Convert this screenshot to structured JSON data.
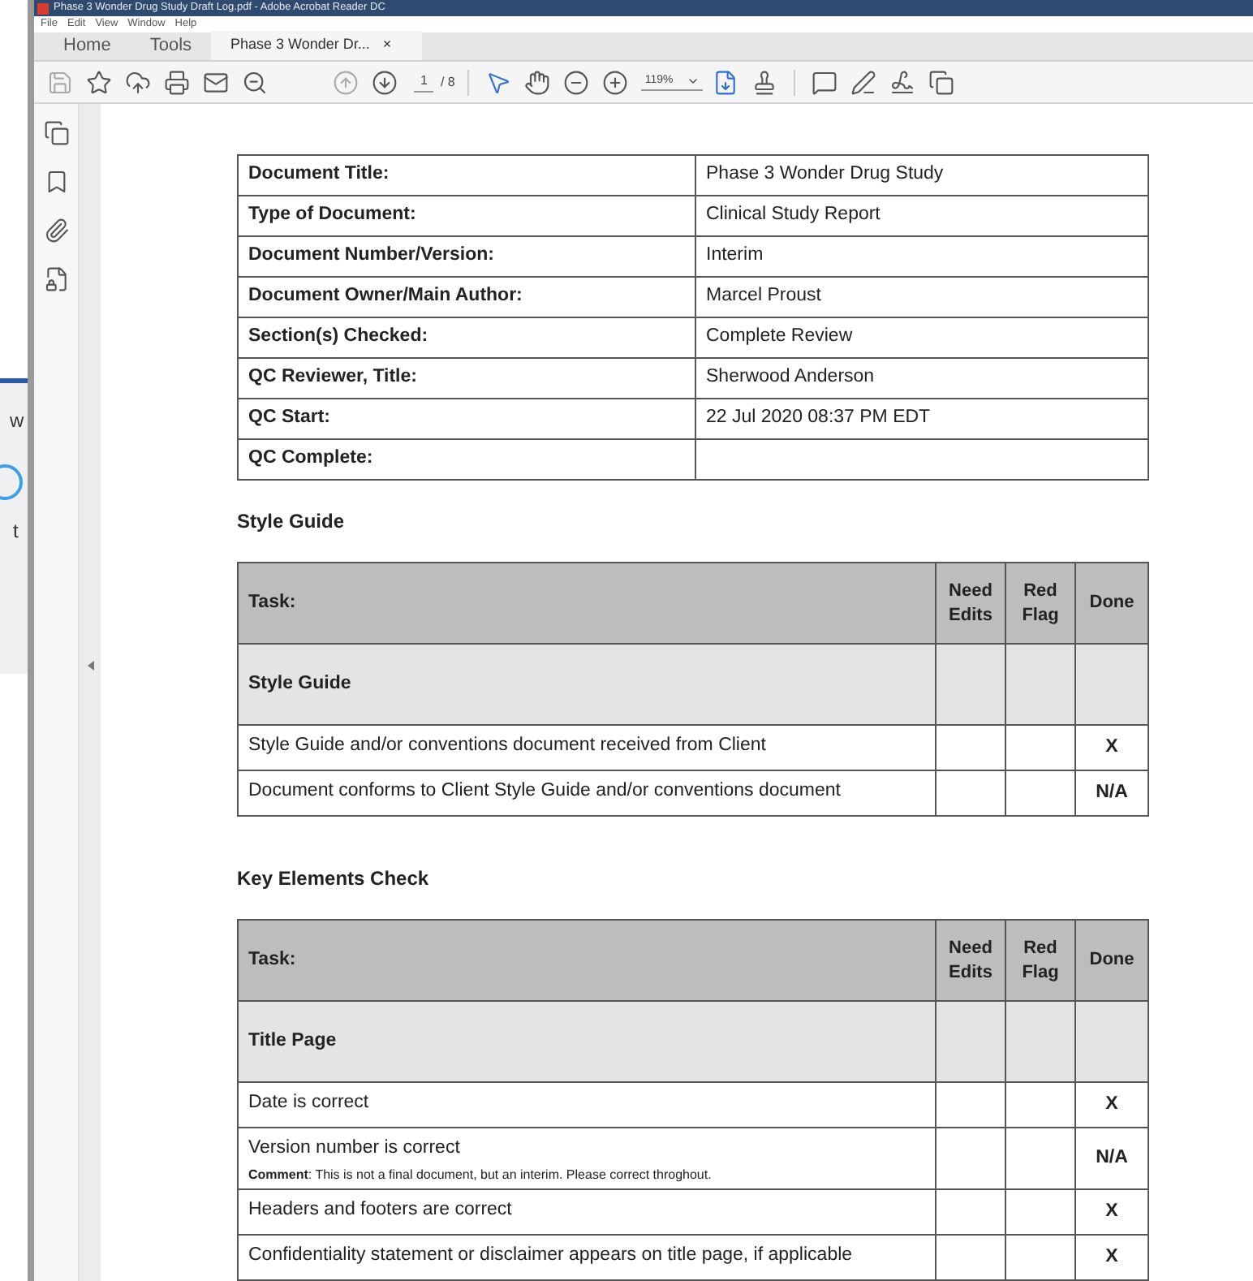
{
  "window": {
    "title": "Phase 3 Wonder Drug Study  Draft Log.pdf - Adobe Acrobat Reader DC"
  },
  "menu": [
    "File",
    "Edit",
    "View",
    "Window",
    "Help"
  ],
  "tabs": [
    {
      "label": "Home",
      "selected": false
    },
    {
      "label": "Tools",
      "selected": false
    },
    {
      "label": "Phase 3 Wonder Dr...",
      "selected": true,
      "close": "×"
    }
  ],
  "toolbar": {
    "page_number": "1",
    "page_total": "/ 8",
    "zoom": "119%"
  },
  "background_window": {
    "texts": [
      "w",
      "t"
    ]
  },
  "document": {
    "info_table": [
      {
        "label": "Document Title:",
        "value": "Phase 3 Wonder Drug Study"
      },
      {
        "label": "Type of Document:",
        "value": "Clinical Study Report"
      },
      {
        "label": "Document Number/Version:",
        "value": "Interim"
      },
      {
        "label": "Document Owner/Main Author:",
        "value": "Marcel Proust"
      },
      {
        "label": "Section(s) Checked:",
        "value": "Complete Review"
      },
      {
        "label": "QC Reviewer, Title:",
        "value": "Sherwood Anderson"
      },
      {
        "label": "QC Start:",
        "value": "22 Jul 2020 08:37 PM EDT"
      },
      {
        "label": "QC Complete:"
      }
    ],
    "sections": [
      {
        "heading": "Style Guide",
        "columns": [
          "Task:",
          "Need Edits",
          "Red Flag",
          "Done"
        ],
        "rows": [
          {
            "kind": "group",
            "task": "Style Guide"
          },
          {
            "kind": "task",
            "task": "Style Guide and/or conventions document received from Client",
            "done": "X"
          },
          {
            "kind": "task",
            "task": "Document conforms to Client Style Guide and/or conventions document",
            "done": "N/A"
          }
        ]
      },
      {
        "heading": "Key Elements Check",
        "columns": [
          "Task:",
          "Need Edits",
          "Red Flag",
          "Done"
        ],
        "rows": [
          {
            "kind": "group",
            "task": "Title Page"
          },
          {
            "kind": "task",
            "task": "Date is correct",
            "done": "X"
          },
          {
            "kind": "task",
            "task": "Version number is correct",
            "comment": "**Comment**: This is not a final document, but an interim. Please correct throghout.",
            "done": "N/A"
          },
          {
            "kind": "task",
            "task": "Headers and footers are correct",
            "done": "X"
          },
          {
            "kind": "task",
            "task": "Confidentiality statement or disclaimer appears on title page, if applicable",
            "done": "X"
          }
        ]
      }
    ]
  }
}
